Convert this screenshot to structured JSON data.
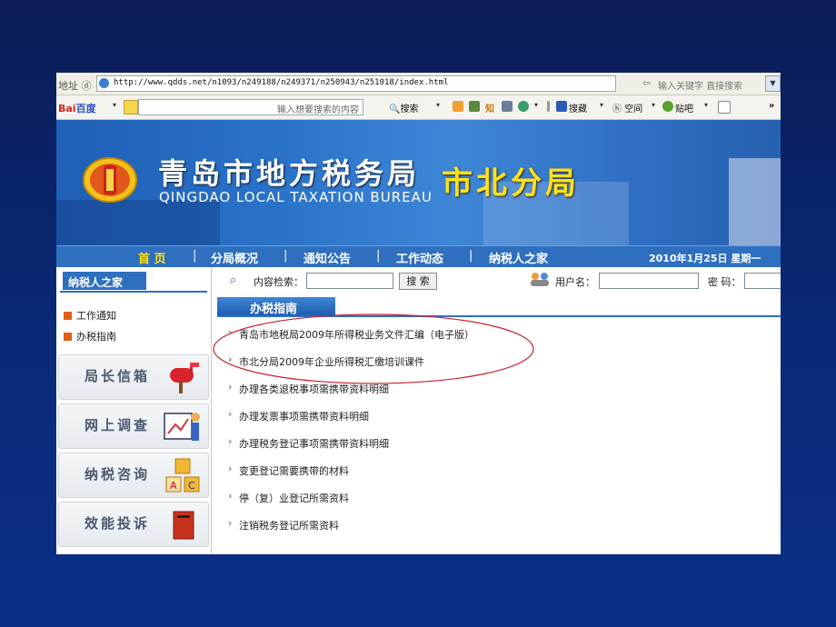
{
  "browser": {
    "address_label": "地址 ⓓ",
    "url": "http://www.qdds.net/n1093/n249188/n249371/n250943/n251018/index.html",
    "search_hint": "输入关键字 直接搜索"
  },
  "toolbar": {
    "logo_a": "Bai",
    "logo_b": "百度",
    "search_placeholder": "输入想要搜索的内容",
    "search_label": "搜索",
    "zhi_label": "知",
    "favorites_label": "搜藏",
    "space_label": "空间",
    "tieba_label": "贴吧"
  },
  "banner": {
    "title_cn": "青岛市地方税务局",
    "title_en": "QINGDAO LOCAL TAXATION BUREAU",
    "subtitle": "市北分局"
  },
  "nav": {
    "items": [
      "首 页",
      "分局概况",
      "通知公告",
      "工作动态",
      "纳税人之家"
    ],
    "date": "2010年1月25日 星期一"
  },
  "sidebar": {
    "header": "纳税人之家",
    "links": [
      "工作通知",
      "办税指南"
    ],
    "cards": [
      "局长信箱",
      "网上调查",
      "纳税咨询",
      "效能投诉"
    ]
  },
  "main": {
    "content_search_label": "内容检索：",
    "search_button": "搜 索",
    "username_label": "用户名：",
    "password_label": "密 码：",
    "section_title": "办税指南",
    "items": [
      "青岛市地税局2009年所得税业务文件汇编（电子版）",
      "市北分局2009年企业所得税汇缴培训课件",
      "办理各类退税事项需携带资料明细",
      "办理发票事项需携带资料明细",
      "办理税务登记事项需携带资料明细",
      "变更登记需要携带的材料",
      "停（复）业登记所需资料",
      "注销税务登记所需资料"
    ]
  },
  "colors": {
    "slide_background": "#0a2a78",
    "nav_blue": "#2e6fc0",
    "subtitle_yellow": "#ffe21a",
    "annotation_red": "#c8202a"
  }
}
